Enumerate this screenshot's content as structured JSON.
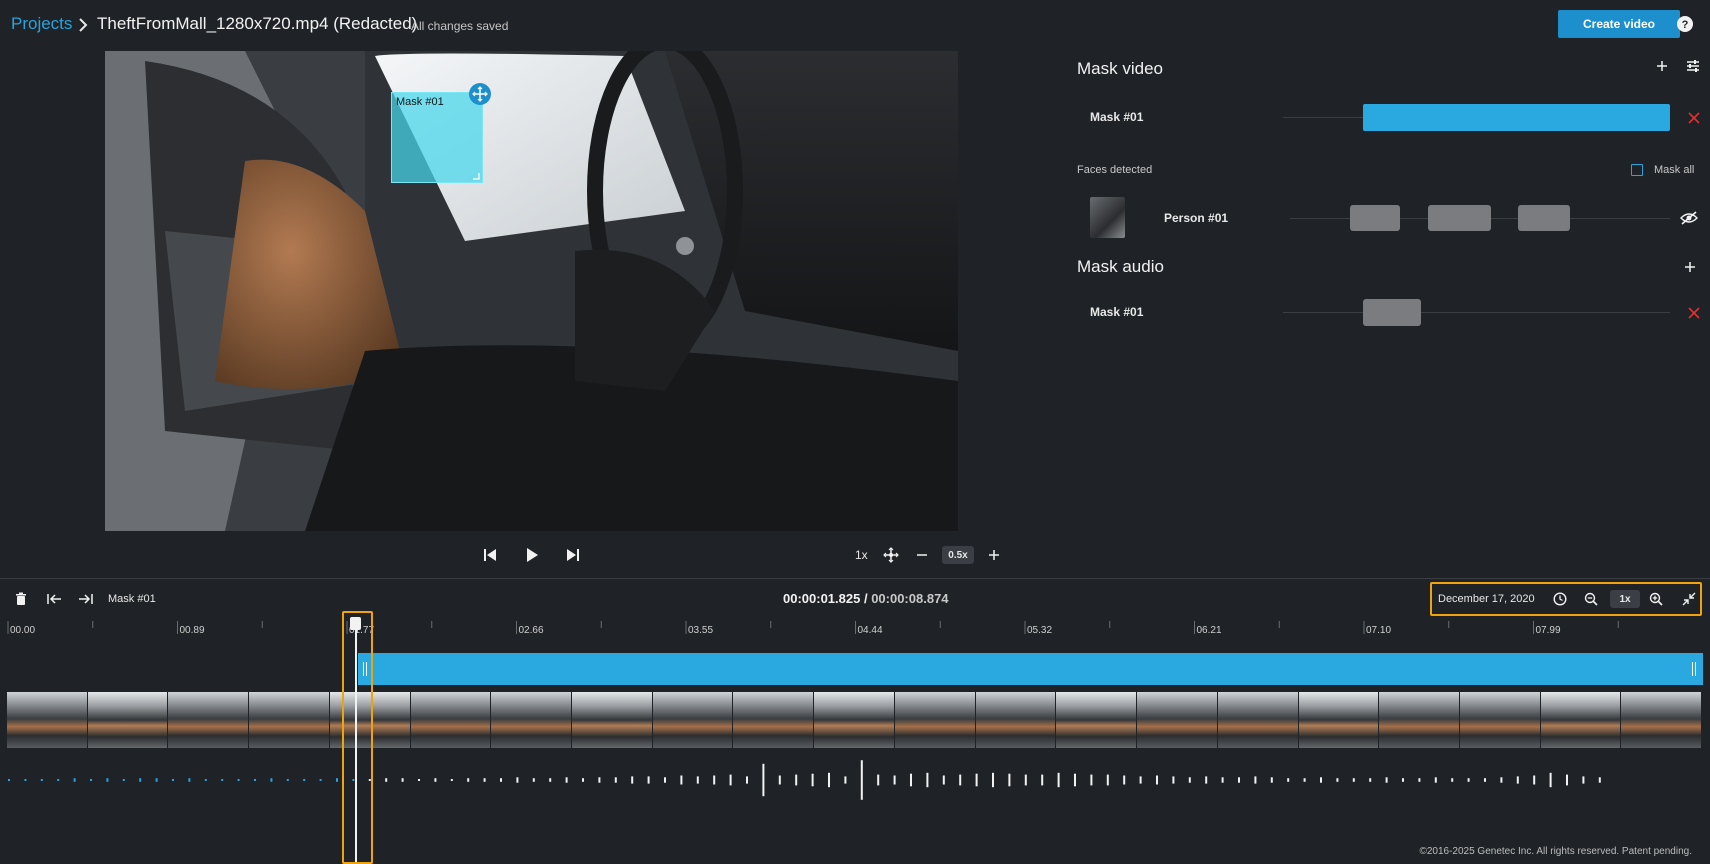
{
  "header": {
    "breadcrumb_root": "Projects",
    "project_title": "TheftFromMall_1280x720.mp4 (Redacted)",
    "save_status": "All changes saved",
    "create_button": "Create video"
  },
  "video": {
    "mask_label": "Mask #01"
  },
  "player": {
    "speed": "1x",
    "zoom": "0.5x"
  },
  "panel": {
    "mask_video_title": "Mask video",
    "mask_video_rows": [
      {
        "label": "Mask #01"
      }
    ],
    "faces_title": "Faces detected",
    "mask_all_label": "Mask all",
    "faces": [
      {
        "label": "Person #01"
      }
    ],
    "mask_audio_title": "Mask audio",
    "mask_audio_rows": [
      {
        "label": "Mask #01"
      }
    ]
  },
  "timeline": {
    "selected_mask": "Mask #01",
    "current_time": "00:00:01.825",
    "separator": " / ",
    "total_time": "00:00:08.874",
    "date": "December 17, 2020",
    "zoom": "1x",
    "ticks": [
      "00.00",
      "00.89",
      "01.77",
      "02.66",
      "03.55",
      "04.44",
      "05.32",
      "06.21",
      "07.10",
      "07.99"
    ]
  },
  "footer": {
    "copyright": "©2016-2025 Genetec Inc. All rights reserved. Patent pending."
  },
  "colors": {
    "accent": "#29a3dc",
    "highlight": "#f0a30a",
    "delete": "#e0312e"
  },
  "icons": [
    "chevron-right-icon",
    "help-icon",
    "move-icon",
    "skip-back-icon",
    "play-icon",
    "skip-forward-icon",
    "pan-icon",
    "minus-icon",
    "plus-icon",
    "settings-sliders-icon",
    "close-icon",
    "eye-off-icon",
    "trash-icon",
    "go-start-icon",
    "go-end-icon",
    "clock-icon",
    "zoom-out-icon",
    "zoom-in-icon",
    "collapse-icon"
  ]
}
